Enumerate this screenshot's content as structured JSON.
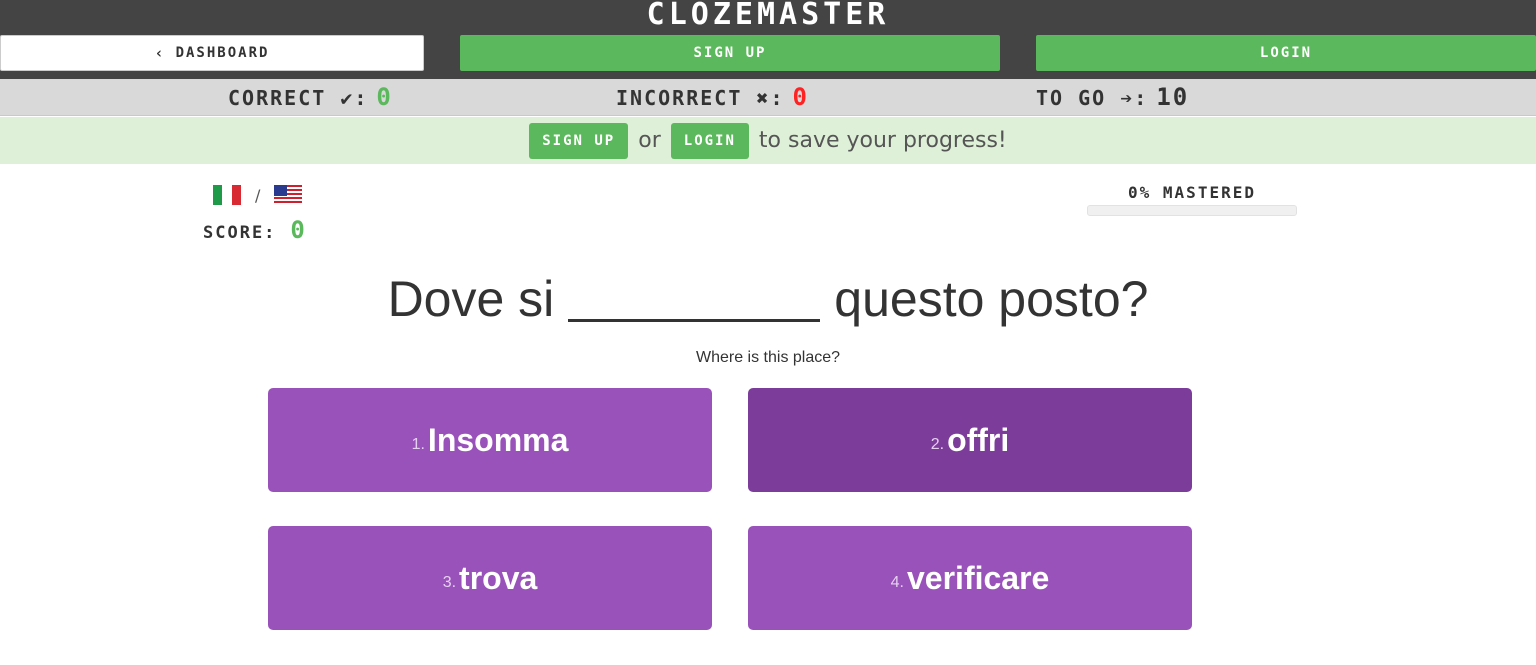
{
  "header": {
    "brand": "CLOZEMASTER",
    "dashboard_label": "DASHBOARD",
    "signup_label": "SIGN UP",
    "login_label": "LOGIN"
  },
  "stats": {
    "correct_label": "CORRECT ✔:",
    "correct_value": "0",
    "incorrect_label": "INCORRECT ✖:",
    "incorrect_value": "0",
    "togo_label": "TO GO ➔:",
    "togo_value": "10"
  },
  "promo": {
    "signup_label": "SIGN UP",
    "or_text": "or",
    "login_label": "LOGIN",
    "suffix_text": "to save your progress!"
  },
  "language_pair": {
    "separator": "/",
    "from_flag": "italy-flag-icon",
    "to_flag": "usa-flag-icon"
  },
  "score": {
    "label": "SCORE:",
    "value": "0"
  },
  "mastery": {
    "label": "0% MASTERED",
    "fraction": 0.0
  },
  "question": {
    "before_blank": "Dove si",
    "after_blank": "questo posto?",
    "translation": "Where is this place?"
  },
  "choices": [
    {
      "number": "1.",
      "word": "Insomma"
    },
    {
      "number": "2.",
      "word": "offri"
    },
    {
      "number": "3.",
      "word": "trova"
    },
    {
      "number": "4.",
      "word": "verificare"
    }
  ],
  "colors": {
    "brand_bar": "#444444",
    "primary_green": "#5cb85c",
    "incorrect_red": "#ff2222",
    "choice_purple": "#9a52bb",
    "choice_purple_hover": "#7c3c9a",
    "promo_background": "#dff0d8"
  }
}
